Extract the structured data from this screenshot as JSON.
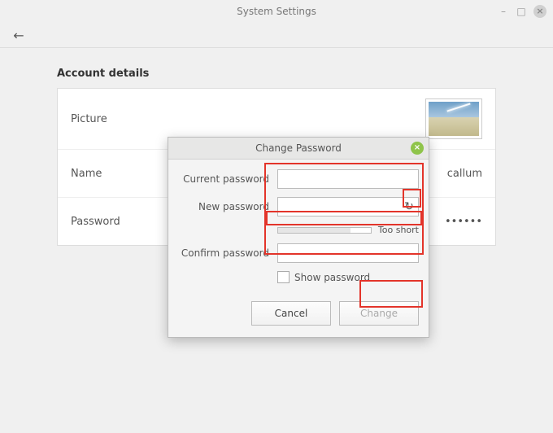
{
  "window": {
    "title": "System Settings"
  },
  "section": {
    "title": "Account details"
  },
  "rows": {
    "picture_label": "Picture",
    "name_label": "Name",
    "name_value": "callum",
    "password_label": "Password",
    "password_value": "••••••"
  },
  "dialog": {
    "title": "Change Password",
    "current_label": "Current password",
    "new_label": "New password",
    "confirm_label": "Confirm password",
    "strength_text": "Too short",
    "show_pw_label": "Show password",
    "cancel": "Cancel",
    "change": "Change",
    "current_value": "",
    "new_value": "",
    "confirm_value": ""
  }
}
